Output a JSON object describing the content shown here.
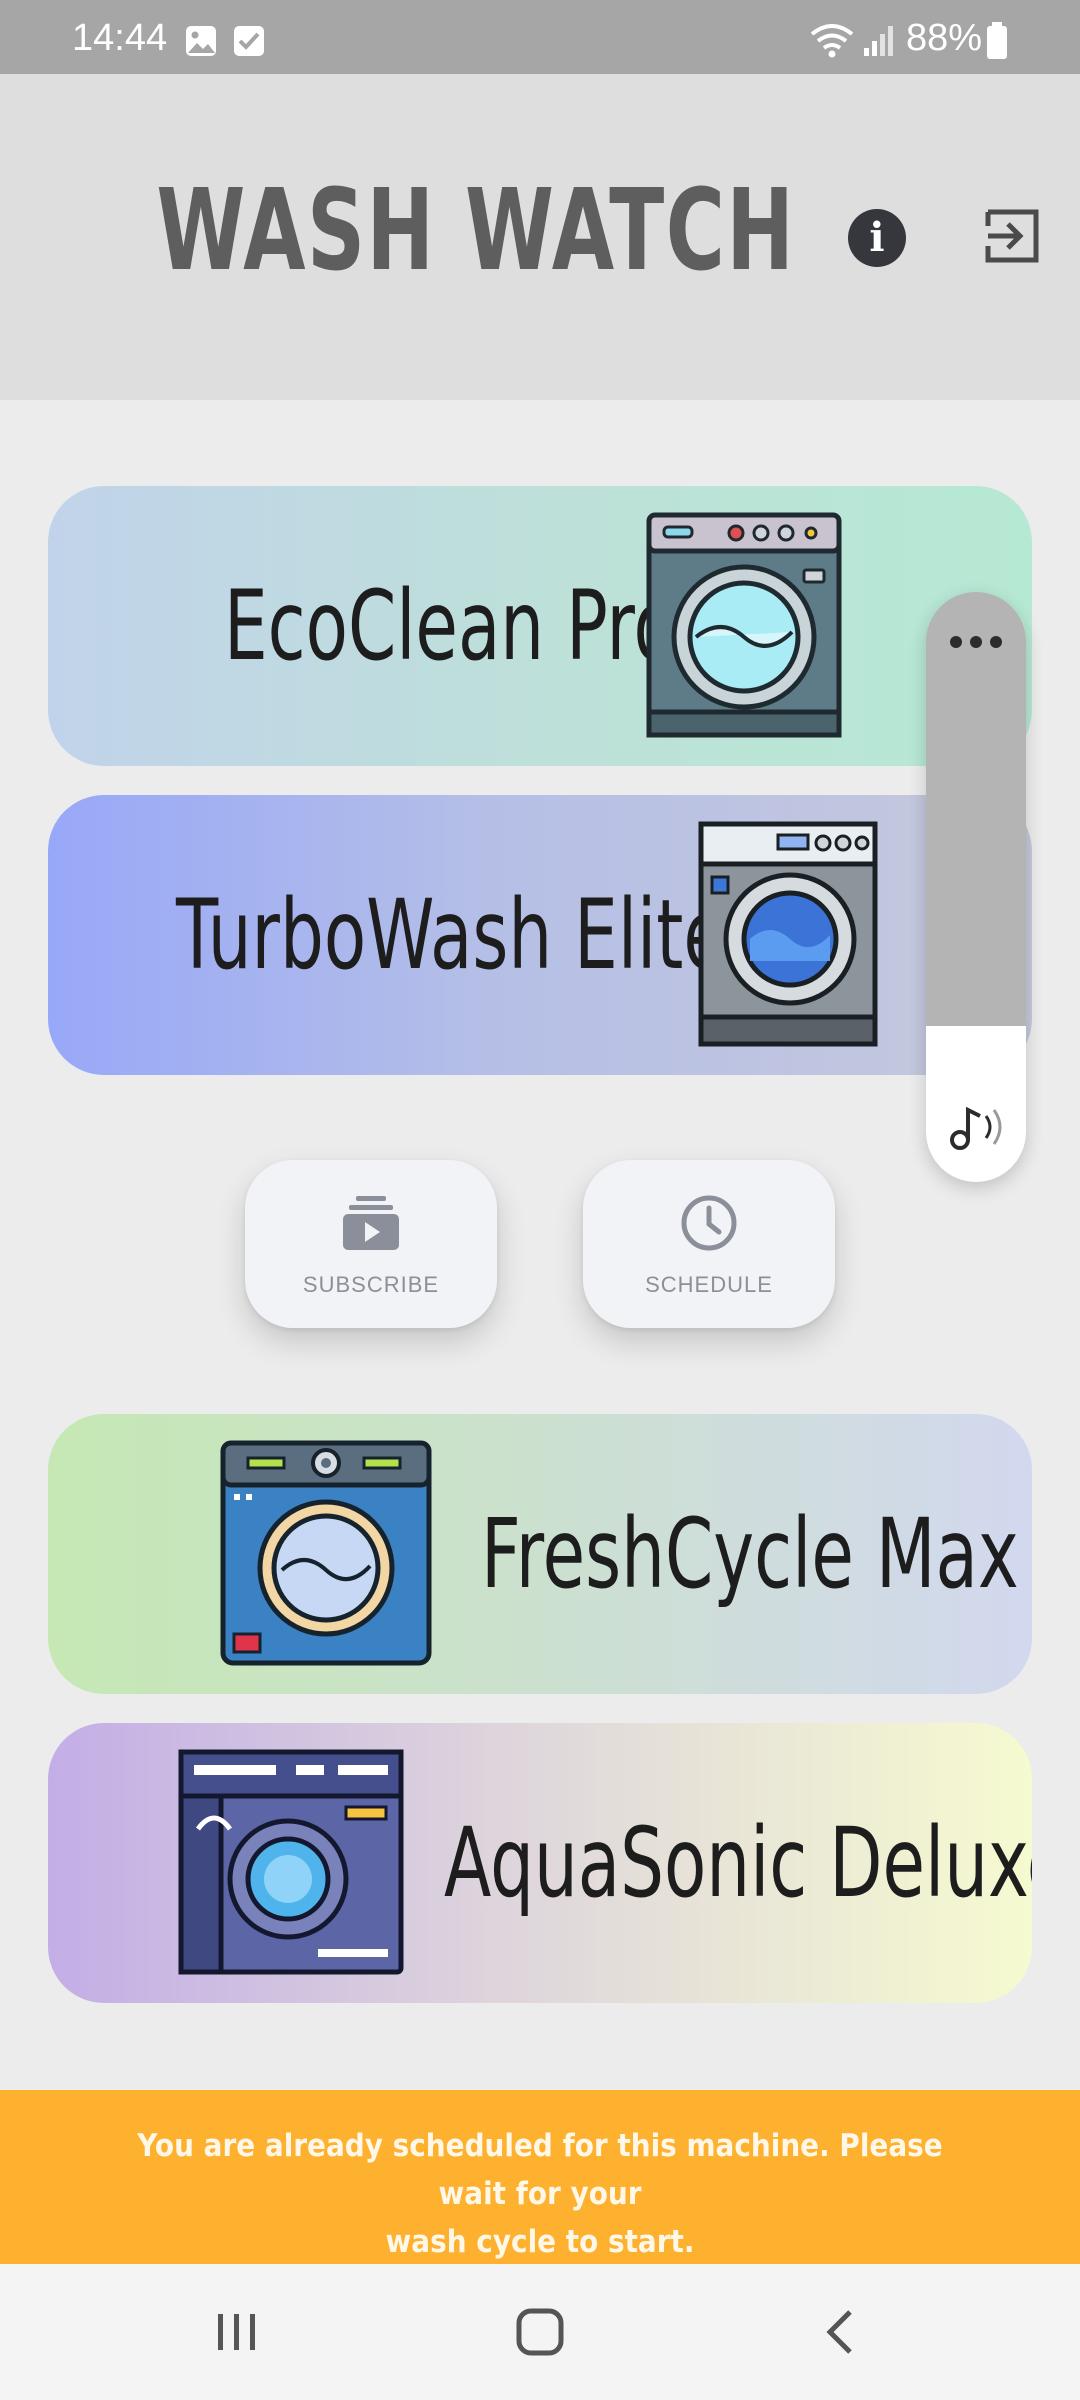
{
  "status_bar": {
    "time": "14:44",
    "battery": "88%",
    "icons": [
      "gallery-icon",
      "check-box-icon",
      "wifi-icon",
      "signal-icon",
      "battery-icon"
    ]
  },
  "header": {
    "title": "WASH WATCH",
    "info_icon": "info-icon",
    "logout_icon": "logout-icon"
  },
  "machines": [
    {
      "name": "EcoClean Pro",
      "icon": "washing-machine-icon"
    },
    {
      "name": "TurboWash Elite",
      "icon": "washing-machine-icon"
    },
    {
      "name": "FreshCycle Max",
      "icon": "washing-machine-icon"
    },
    {
      "name": "AquaSonic Deluxe",
      "icon": "washing-machine-icon"
    }
  ],
  "actions": {
    "subscribe_label": "SUBSCRIBE",
    "schedule_label": "SCHEDULE"
  },
  "audio_panel": {
    "more_icon": "more-dots-icon",
    "music_icon": "music-note-icon"
  },
  "toast": {
    "message_line1": "You are already scheduled for this machine. Please wait for your",
    "message_line2": "wash cycle to start."
  },
  "colors": {
    "toast_bg": "#feb12f",
    "title": "#5e5e5e",
    "header_bg": "#dedede"
  },
  "nav_bar": {
    "icons": [
      "recent-apps-icon",
      "home-icon",
      "back-icon"
    ]
  }
}
